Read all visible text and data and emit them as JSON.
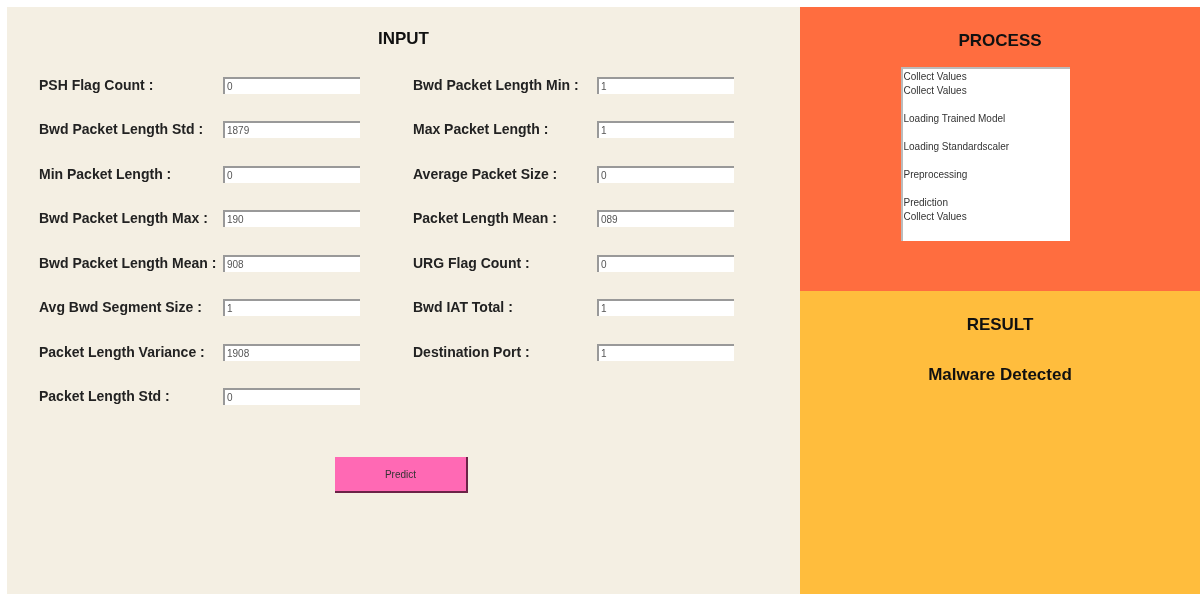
{
  "input_panel": {
    "title": "INPUT",
    "left_fields": [
      {
        "label": "PSH Flag Count :",
        "value": "0"
      },
      {
        "label": "Bwd Packet Length Std :",
        "value": "1879"
      },
      {
        "label": "Min Packet Length :",
        "value": "0"
      },
      {
        "label": "Bwd Packet Length Max :",
        "value": "190"
      },
      {
        "label": "Bwd Packet Length Mean :",
        "value": "908"
      },
      {
        "label": "Avg Bwd Segment Size :",
        "value": "1"
      },
      {
        "label": "Packet Length Variance :",
        "value": "1908"
      },
      {
        "label": "Packet Length Std :",
        "value": "0"
      }
    ],
    "right_fields": [
      {
        "label": "Bwd Packet Length Min :",
        "value": "1"
      },
      {
        "label": "Max Packet Length :",
        "value": "1"
      },
      {
        "label": "Average Packet Size :",
        "value": "0"
      },
      {
        "label": "Packet Length Mean :",
        "value": "089"
      },
      {
        "label": "URG Flag Count :",
        "value": "0"
      },
      {
        "label": "Bwd IAT Total :",
        "value": "1"
      },
      {
        "label": "Destination Port :",
        "value": "1"
      }
    ],
    "button": "Predict"
  },
  "process_panel": {
    "title": "PROCESS",
    "log_groups": [
      [
        "Collect Values",
        "Collect Values"
      ],
      [
        "Loading Trained Model"
      ],
      [
        "Loading Standardscaler"
      ],
      [
        "Preprocessing"
      ],
      [
        "Prediction",
        "Collect Values"
      ]
    ]
  },
  "result_panel": {
    "title": "RESULT",
    "message": "Malware Detected"
  }
}
